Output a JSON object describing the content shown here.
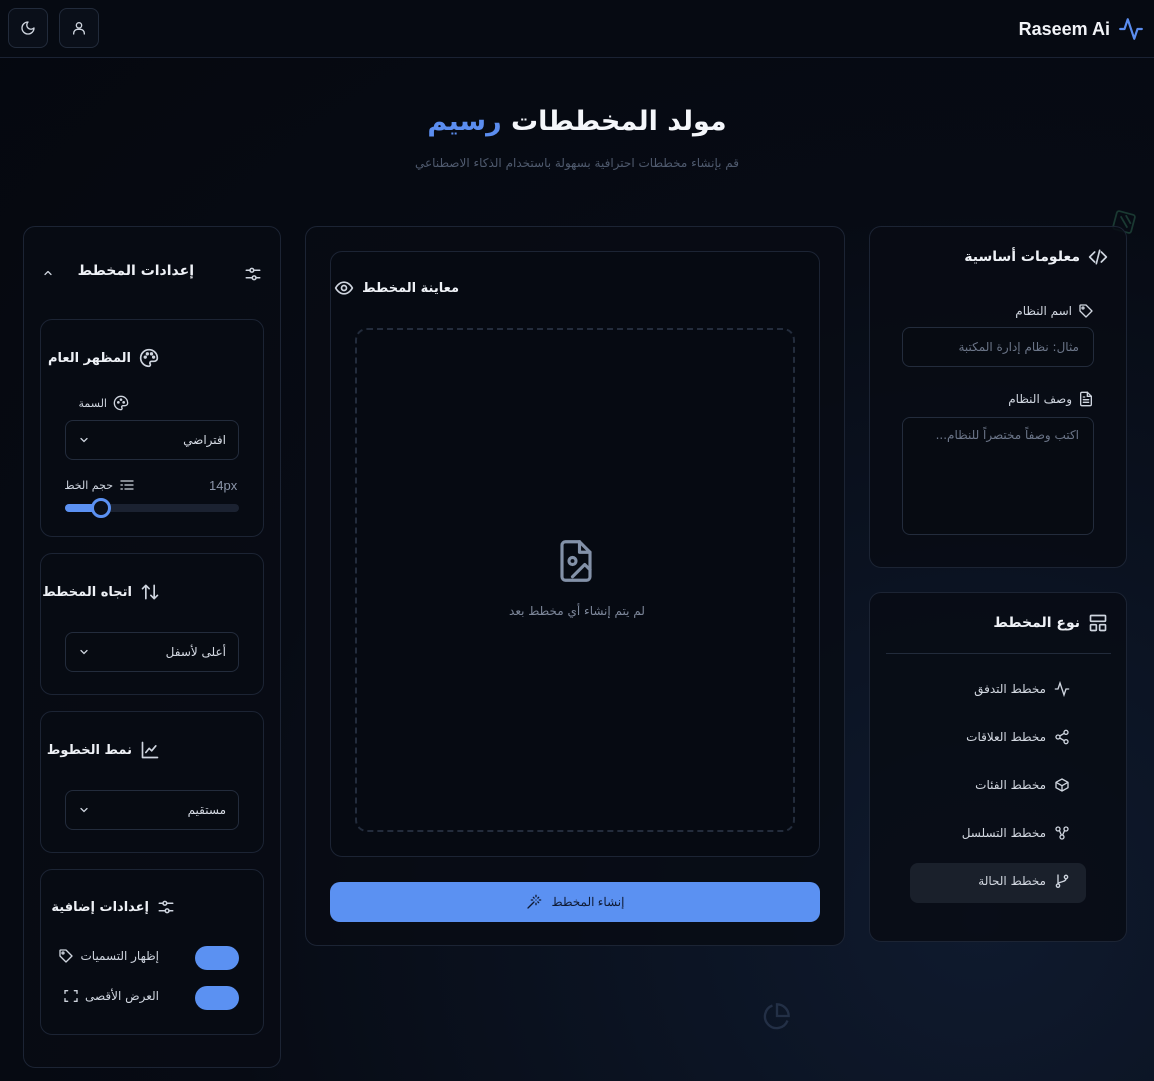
{
  "app": {
    "name": "Raseem Ai"
  },
  "hero": {
    "title_main": "مولد المخططات",
    "title_accent": "رسيم",
    "subtitle": "قم بإنشاء مخططات احترافية بسهولة باستخدام الذكاء الاصطناعي"
  },
  "settings": {
    "title": "إعدادات المخطط",
    "appearance": {
      "title": "المظهر العام",
      "theme_label": "السمة",
      "theme_value": "افتراضي",
      "font_size_label": "حجم الخط",
      "font_size_value": "14px",
      "font_size_level": 0.2
    },
    "direction": {
      "title": "اتجاه المخطط",
      "value": "أعلى لأسفل"
    },
    "line_style": {
      "title": "نمط الخطوط",
      "value": "مستقيم"
    },
    "extra": {
      "title": "إعدادات إضافية",
      "show_labels": "إظهار التسميات",
      "max_width": "العرض الأقصى"
    }
  },
  "preview": {
    "title": "معاينة المخطط",
    "empty_text": "لم يتم إنشاء أي مخطط بعد",
    "generate_label": "إنشاء المخطط"
  },
  "basic_info": {
    "title": "معلومات أساسية",
    "name_label": "اسم النظام",
    "name_placeholder": "مثال: نظام إدارة المكتبة",
    "desc_label": "وصف النظام",
    "desc_placeholder": "اكتب وصفاً مختصراً للنظام..."
  },
  "diagram_type": {
    "title": "نوع المخطط",
    "items": [
      {
        "label": "مخطط التدفق"
      },
      {
        "label": "مخطط العلاقات"
      },
      {
        "label": "مخطط الفئات"
      },
      {
        "label": "مخطط التسلسل"
      },
      {
        "label": "مخطط الحالة",
        "selected": true
      }
    ]
  },
  "colors": {
    "accent": "#5b91f2",
    "background": "#070b14"
  }
}
